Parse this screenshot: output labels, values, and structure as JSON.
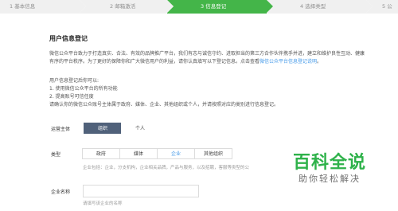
{
  "stepper": {
    "steps": [
      {
        "label": "1 基本信息"
      },
      {
        "label": "2 邮箱激活"
      },
      {
        "label": "3 信息登记"
      },
      {
        "label": "4 选择类型"
      },
      {
        "label": "5 公"
      }
    ],
    "active_index": 2,
    "colors": {
      "active": "#44b549",
      "inactive": "#f0f0f0"
    }
  },
  "main": {
    "title": "用户信息登记",
    "intro_line1": "微信公众平台致力于打造真实、合法、有效的品牌推广平台，我们有志与诚信守约、进取担当的第三方合作伙伴携手并进，建立和维护良性互动、健康",
    "intro_line2_prefix": "有序的平台秩序。为了更好的保障你和广大微信用户的利益，请你认真填写以下登记信息。点击查看",
    "intro_link": "微信公众平台信息登记说明",
    "intro_line2_suffix": "。",
    "purpose_title": "用户信息登记后你可以:",
    "purpose_items": [
      "1. 使用微信公众平台的所有功能",
      "2. 提高账号可信任度"
    ],
    "purpose_note": "请确认你的微信公众账号主体属于政府、媒体、企业、其他组织或个人，并请按照对应的类别进行信息登记。"
  },
  "form": {
    "subject_label": "运营主体",
    "subject_options": [
      "组织",
      "个人"
    ],
    "subject_selected": "组织",
    "type_label": "类型",
    "type_options": [
      "政府",
      "媒体",
      "企业",
      "其他组织"
    ],
    "type_selected": "企业",
    "type_hint": "企业包括：企业，分支机构，企业相关品牌，产品与服务，以及招聘，客服等类型的公",
    "org_name_label": "企业名称",
    "org_name_value": "",
    "org_name_hint": "请填写该企业的名称"
  },
  "watermark": {
    "main": "百科全说",
    "sub": "助你轻松解决",
    "color": "#2eb24a"
  }
}
